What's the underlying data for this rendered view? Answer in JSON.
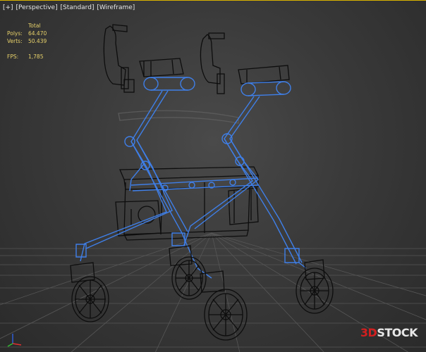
{
  "viewport": {
    "labels": [
      "[+]",
      "[Perspective]",
      "[Standard]",
      "[Wireframe]"
    ]
  },
  "stats": {
    "header": "Total",
    "polys_label": "Polys:",
    "polys_value": "64.470",
    "verts_label": "Verts:",
    "verts_value": "50.439",
    "fps_label": "FPS:",
    "fps_value": "1,785"
  },
  "watermark": {
    "prefix": "3D",
    "suffix": "STOCK"
  },
  "colors": {
    "wire_blue": "#3f7fe8",
    "wire_black": "#0d0d0d",
    "stats_yellow": "#e8d26a",
    "brand_red": "#d21f1f",
    "gizmo_x": "#e03030",
    "gizmo_y": "#30c030",
    "gizmo_z": "#3060e0"
  }
}
